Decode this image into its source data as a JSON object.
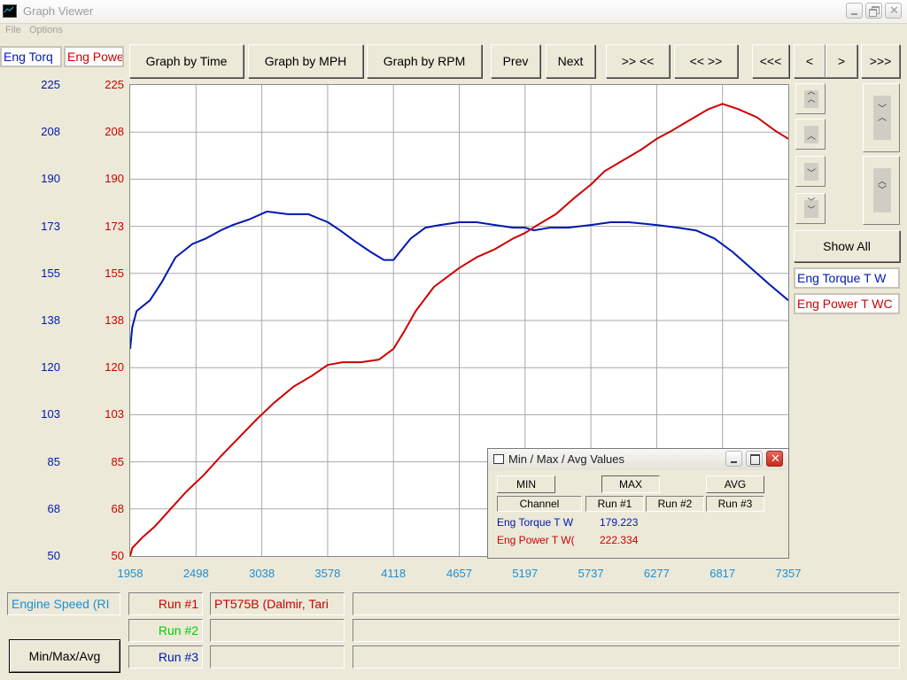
{
  "window": {
    "title": "Graph Viewer"
  },
  "menu": [
    "File",
    "Options"
  ],
  "header": {
    "left_axis_label": "Eng Torq",
    "right_axis_label": "Eng Powe"
  },
  "toolbar": {
    "graph_by_time": "Graph by Time",
    "graph_by_mph": "Graph by MPH",
    "graph_by_rpm": "Graph by RPM",
    "prev": "Prev",
    "next": "Next",
    "zoom_in": ">> <<",
    "zoom_out": "<< >>",
    "scroll_far_left": "<<<",
    "scroll_left": "<",
    "scroll_right": ">",
    "scroll_far_right": ">>>"
  },
  "side": {
    "show_all": "Show All",
    "legend": [
      {
        "label": "Eng Torque T W",
        "color": "#0018b0"
      },
      {
        "label": "Eng Power T WC",
        "color": "#cc0000"
      }
    ]
  },
  "chart_data": {
    "type": "line",
    "title": "",
    "xlabel": "Engine Speed (RPM)",
    "x_ticks": [
      "1958",
      "2498",
      "3038",
      "3578",
      "4118",
      "4657",
      "5197",
      "5737",
      "6277",
      "6817",
      "7357"
    ],
    "xlim": [
      1958,
      7357
    ],
    "y_ticks_left": [
      "225",
      "208",
      "190",
      "173",
      "155",
      "138",
      "120",
      "103",
      "85",
      "68",
      "50"
    ],
    "y_ticks_right": [
      "225",
      "208",
      "190",
      "173",
      "155",
      "138",
      "120",
      "103",
      "85",
      "68",
      "50"
    ],
    "ylim": [
      50,
      225
    ],
    "grid": true,
    "series": [
      {
        "name": "Eng Torque T W",
        "color": "#0018b0",
        "x": [
          1958,
          1975,
          2010,
          2120,
          2220,
          2330,
          2470,
          2580,
          2700,
          2800,
          2930,
          3080,
          3250,
          3420,
          3580,
          3680,
          3800,
          3930,
          4040,
          4118,
          4170,
          4260,
          4380,
          4500,
          4657,
          4800,
          4950,
          5100,
          5197,
          5270,
          5400,
          5550,
          5737,
          5900,
          6050,
          6277,
          6450,
          6600,
          6750,
          6900,
          7050,
          7200,
          7357
        ],
        "y": [
          127,
          135,
          141,
          145,
          152,
          161,
          166,
          168,
          171,
          173,
          175,
          178,
          177,
          177,
          174,
          171,
          167,
          163,
          160,
          160,
          163,
          168,
          172,
          173,
          174,
          174,
          173,
          172,
          172,
          171,
          172,
          172,
          173,
          174,
          174,
          173,
          172,
          171,
          168,
          163,
          157,
          151,
          145
        ]
      },
      {
        "name": "Eng Power T WC",
        "color": "#cc0000",
        "x": [
          1958,
          1975,
          2060,
          2160,
          2280,
          2420,
          2560,
          2700,
          2850,
          3000,
          3140,
          3300,
          3450,
          3578,
          3700,
          3850,
          4000,
          4118,
          4200,
          4300,
          4450,
          4657,
          4800,
          4950,
          5100,
          5197,
          5300,
          5450,
          5600,
          5737,
          5850,
          6000,
          6150,
          6277,
          6400,
          6550,
          6700,
          6817,
          6950,
          7100,
          7250,
          7357
        ],
        "y": [
          50,
          53,
          57,
          61,
          67,
          74,
          80,
          87,
          94,
          101,
          107,
          113,
          117,
          121,
          122,
          122,
          123,
          127,
          133,
          141,
          150,
          157,
          161,
          164,
          168,
          170,
          173,
          177,
          183,
          188,
          193,
          197,
          201,
          205,
          208,
          212,
          216,
          218,
          216,
          213,
          208,
          205
        ]
      }
    ]
  },
  "dialog": {
    "title": "Min / Max / Avg Values",
    "min_label": "MIN",
    "max_label": "MAX",
    "avg_label": "AVG",
    "col_channel": "Channel",
    "col_run1": "Run #1",
    "col_run2": "Run #2",
    "col_run3": "Run #3",
    "rows": [
      {
        "channel": "Eng Torque T W",
        "run1": "179.223",
        "color": "#0018b0"
      },
      {
        "channel": "Eng Power T W(",
        "run1": "222.334",
        "color": "#cc0000"
      }
    ]
  },
  "bottom": {
    "x_channel": "Engine Speed (RI",
    "runs": [
      {
        "label": "Run #1",
        "color": "#cc0000",
        "name": "PT575B (Dalmir, Tari"
      },
      {
        "label": "Run #2",
        "color": "#00cc00",
        "name": ""
      },
      {
        "label": "Run #3",
        "color": "#0018b0",
        "name": ""
      }
    ],
    "min_max_avg_button": "Min/Max/Avg"
  }
}
